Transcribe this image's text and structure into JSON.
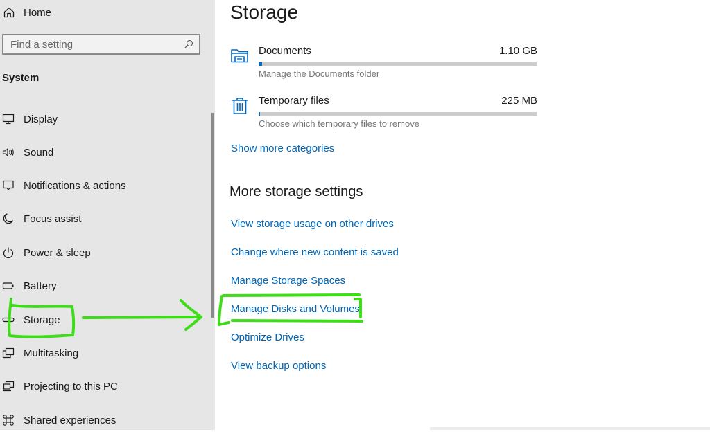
{
  "sidebar": {
    "home": {
      "label": "Home",
      "icon": "home-icon"
    },
    "search": {
      "placeholder": "Find a setting",
      "value": "",
      "icon": "search-icon"
    },
    "group_title": "System",
    "items": [
      {
        "label": "Display",
        "icon": "monitor-icon"
      },
      {
        "label": "Sound",
        "icon": "speaker-icon"
      },
      {
        "label": "Notifications & actions",
        "icon": "notification-icon"
      },
      {
        "label": "Focus assist",
        "icon": "moon-icon"
      },
      {
        "label": "Power & sleep",
        "icon": "power-icon"
      },
      {
        "label": "Battery",
        "icon": "battery-icon"
      },
      {
        "label": "Storage",
        "icon": "storage-drive-icon",
        "selected": true
      },
      {
        "label": "Multitasking",
        "icon": "multitasking-icon"
      },
      {
        "label": "Projecting to this PC",
        "icon": "projecting-icon"
      },
      {
        "label": "Shared experiences",
        "icon": "shared-experiences-icon"
      }
    ]
  },
  "main": {
    "title": "Storage",
    "categories": [
      {
        "name": "Documents",
        "size": "1.10 GB",
        "description": "Manage the Documents folder",
        "usage_fraction": 0.012,
        "icon": "documents-folder-icon"
      },
      {
        "name": "Temporary files",
        "size": "225 MB",
        "description": "Choose which temporary files to remove",
        "usage_fraction": 0.004,
        "icon": "trash-icon"
      }
    ],
    "show_more_link": "Show more categories",
    "more_settings": {
      "title": "More storage settings",
      "links": [
        "View storage usage on other drives",
        "Change where new content is saved",
        "Manage Storage Spaces",
        "Manage Disks and Volumes",
        "Optimize Drives",
        "View backup options"
      ]
    }
  },
  "colors": {
    "accent": "#0067b8",
    "progress_fill": "#0067c0",
    "sidebar_bg": "#e6e6e6",
    "annotation": "#3fdc1a"
  }
}
